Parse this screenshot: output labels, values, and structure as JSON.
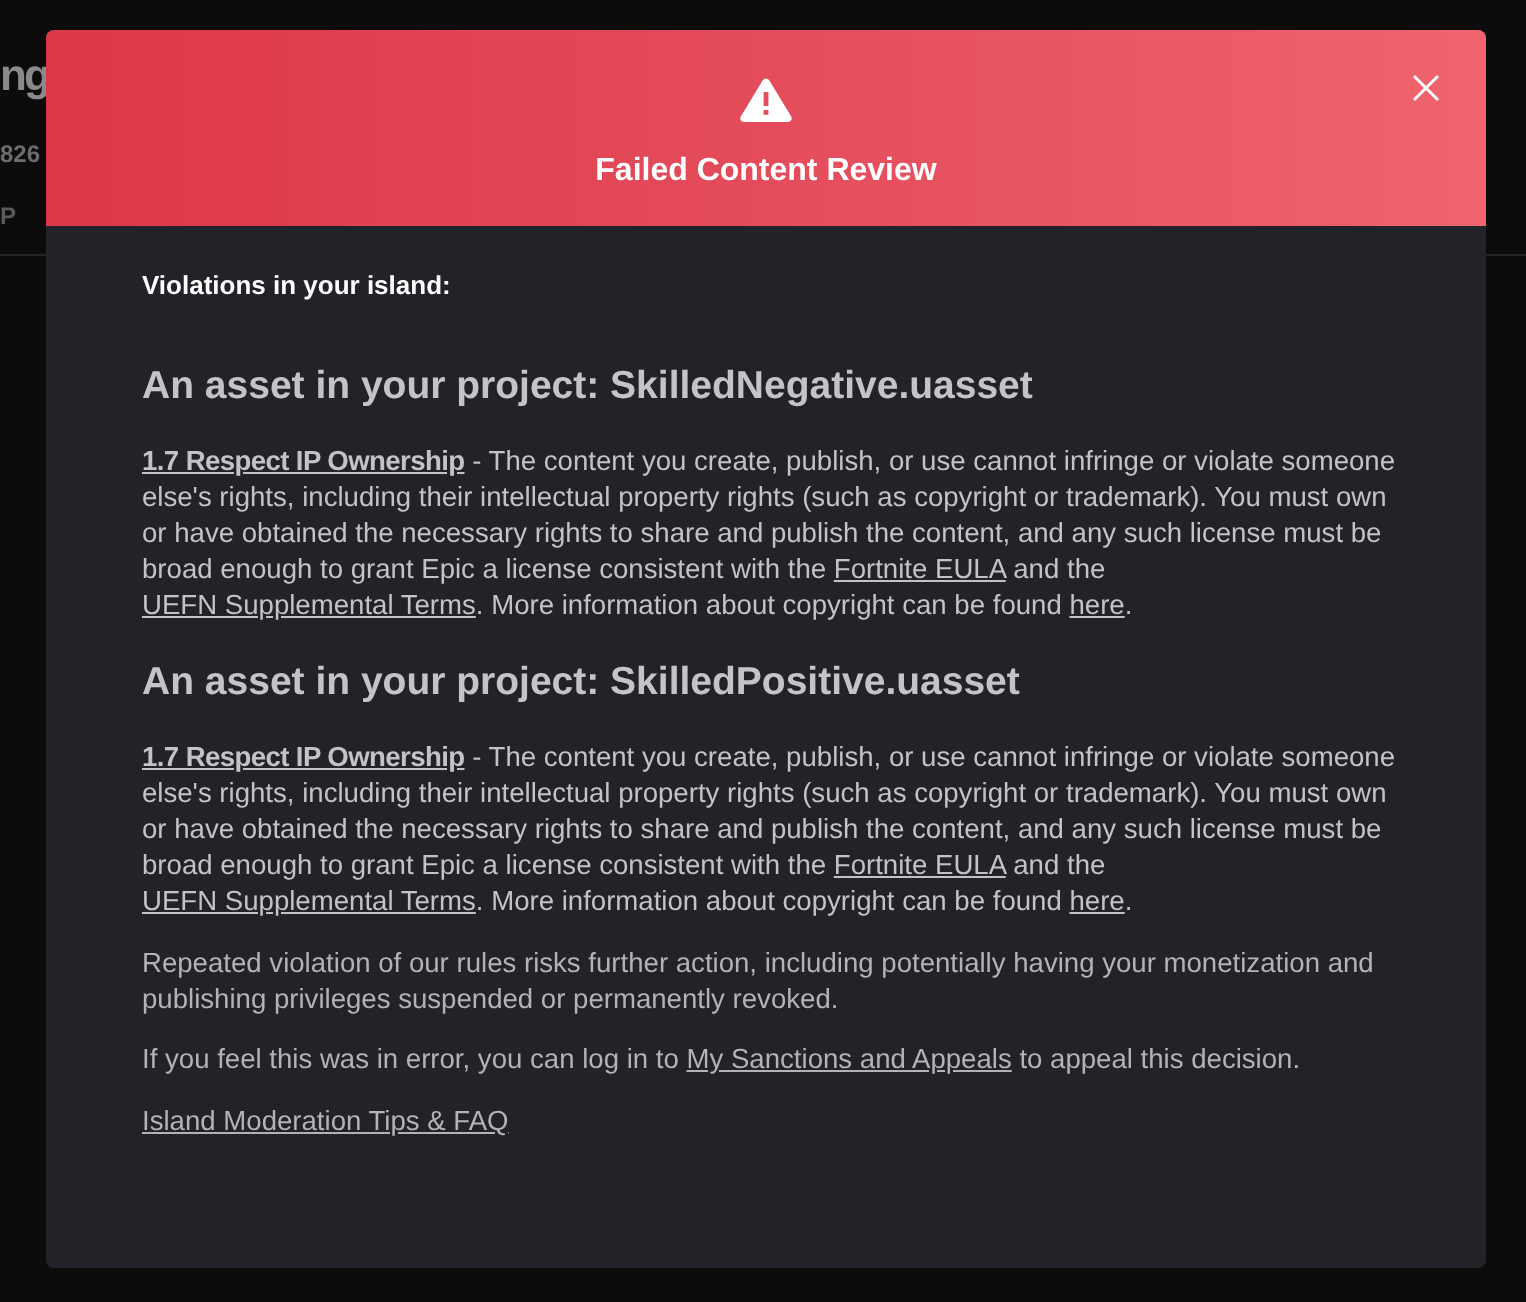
{
  "background": {
    "title": "ng",
    "meta": "826",
    "tab": "P"
  },
  "dialog": {
    "title": "Failed Content Review",
    "intro": "Violations in your island:",
    "violations": [
      {
        "heading": "An asset in your project: SkilledNegative.uasset",
        "segments": [
          {
            "kind": "rule",
            "text": "1.7 Respect IP Ownership"
          },
          {
            "kind": "text",
            "text": " - The content you create, publish, or use cannot infringe or violate someone else's rights, including their intellectual property rights (such as copyright or trademark). You must own or have obtained the necessary rights to share and publish the content, and any such license must be broad enough to grant Epic a license consistent with the "
          },
          {
            "kind": "link",
            "text": "Fortnite EULA"
          },
          {
            "kind": "text",
            "text": " and the "
          },
          {
            "kind": "link",
            "text": "UEFN Supplemental Terms"
          },
          {
            "kind": "text",
            "text": ". More information about copyright can be found "
          },
          {
            "kind": "link",
            "text": "here"
          },
          {
            "kind": "text",
            "text": "."
          }
        ]
      },
      {
        "heading": "An asset in your project: SkilledPositive.uasset",
        "segments": [
          {
            "kind": "rule",
            "text": "1.7 Respect IP Ownership"
          },
          {
            "kind": "text",
            "text": " - The content you create, publish, or use cannot infringe or violate someone else's rights, including their intellectual property rights (such as copyright or trademark). You must own or have obtained the necessary rights to share and publish the content, and any such license must be broad enough to grant Epic a license consistent with the "
          },
          {
            "kind": "link",
            "text": "Fortnite EULA"
          },
          {
            "kind": "text",
            "text": " and the "
          },
          {
            "kind": "link",
            "text": "UEFN Supplemental Terms"
          },
          {
            "kind": "text",
            "text": ". More information about copyright can be found "
          },
          {
            "kind": "link",
            "text": "here"
          },
          {
            "kind": "text",
            "text": "."
          }
        ]
      }
    ],
    "notes": [
      {
        "segments": [
          {
            "kind": "text",
            "text": "Repeated violation of our rules risks further action, including potentially having your monetization and publishing privileges suspended or permanently revoked."
          }
        ]
      },
      {
        "segments": [
          {
            "kind": "text",
            "text": "If you feel this was in error, you can log in to "
          },
          {
            "kind": "link",
            "text": "My Sanctions and Appeals"
          },
          {
            "kind": "text",
            "text": " to appeal this decision."
          }
        ]
      }
    ],
    "footer_link": "Island Moderation Tips & FAQ"
  }
}
